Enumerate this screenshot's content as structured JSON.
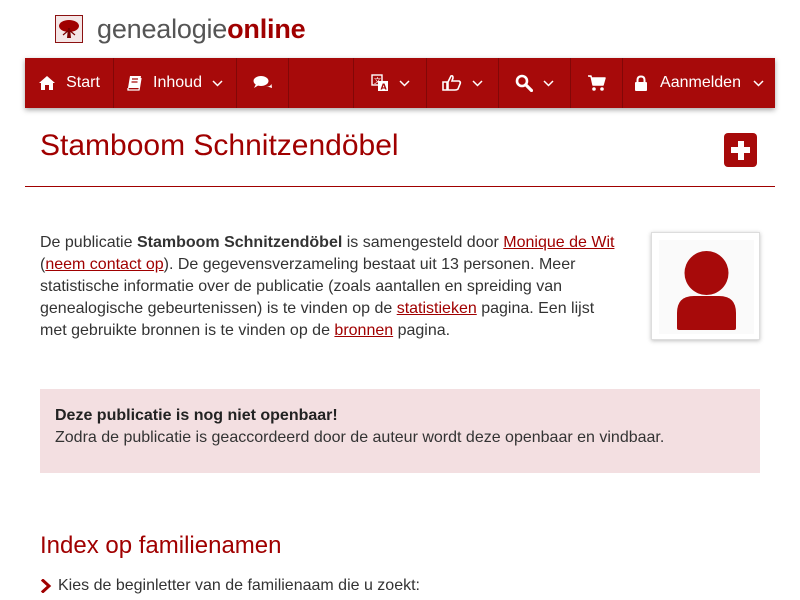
{
  "logo": {
    "part1": "genealogie",
    "part2": "online"
  },
  "nav": {
    "start": "Start",
    "inhoud": "Inhoud",
    "login": "Aanmelden"
  },
  "page": {
    "title": "Stamboom Schnitzendöbel"
  },
  "description": {
    "t1": "De publicatie ",
    "pub_name": "Stamboom Schnitzendöbel",
    "t2": " is samengesteld door ",
    "author": "Monique de Wit",
    "t3": "(",
    "contact": "neem contact op",
    "t4": "). De gegevensverzameling bestaat uit 13 personen. Meer statistische informatie over de publicatie (zoals aantallen en spreiding van genealogische gebeurtenissen) is te vinden op de ",
    "stats": "statistieken",
    "t5": " pagina. Een lijst met gebruikte bronnen is te vinden op de ",
    "sources": "bronnen",
    "t6": " pagina."
  },
  "alert": {
    "heading": "Deze publicatie is nog niet openbaar!",
    "body": "Zodra de publicatie is geaccordeerd door de auteur wordt deze openbaar en vindbaar."
  },
  "index": {
    "title": "Index op familienamen",
    "instruction": "Kies de beginletter van de familienaam die u zoekt:"
  },
  "icons": [
    "tree-logo-icon",
    "home-icon",
    "book-icon",
    "comments-icon",
    "language-icon",
    "thumbs-up-icon",
    "search-icon",
    "cart-icon",
    "lock-icon",
    "plus-icon",
    "user-icon",
    "chevron-right-icon"
  ],
  "colors": {
    "brand": "#a70a0a",
    "accent_text": "#a00000",
    "alert_bg": "#f3dfe1"
  }
}
